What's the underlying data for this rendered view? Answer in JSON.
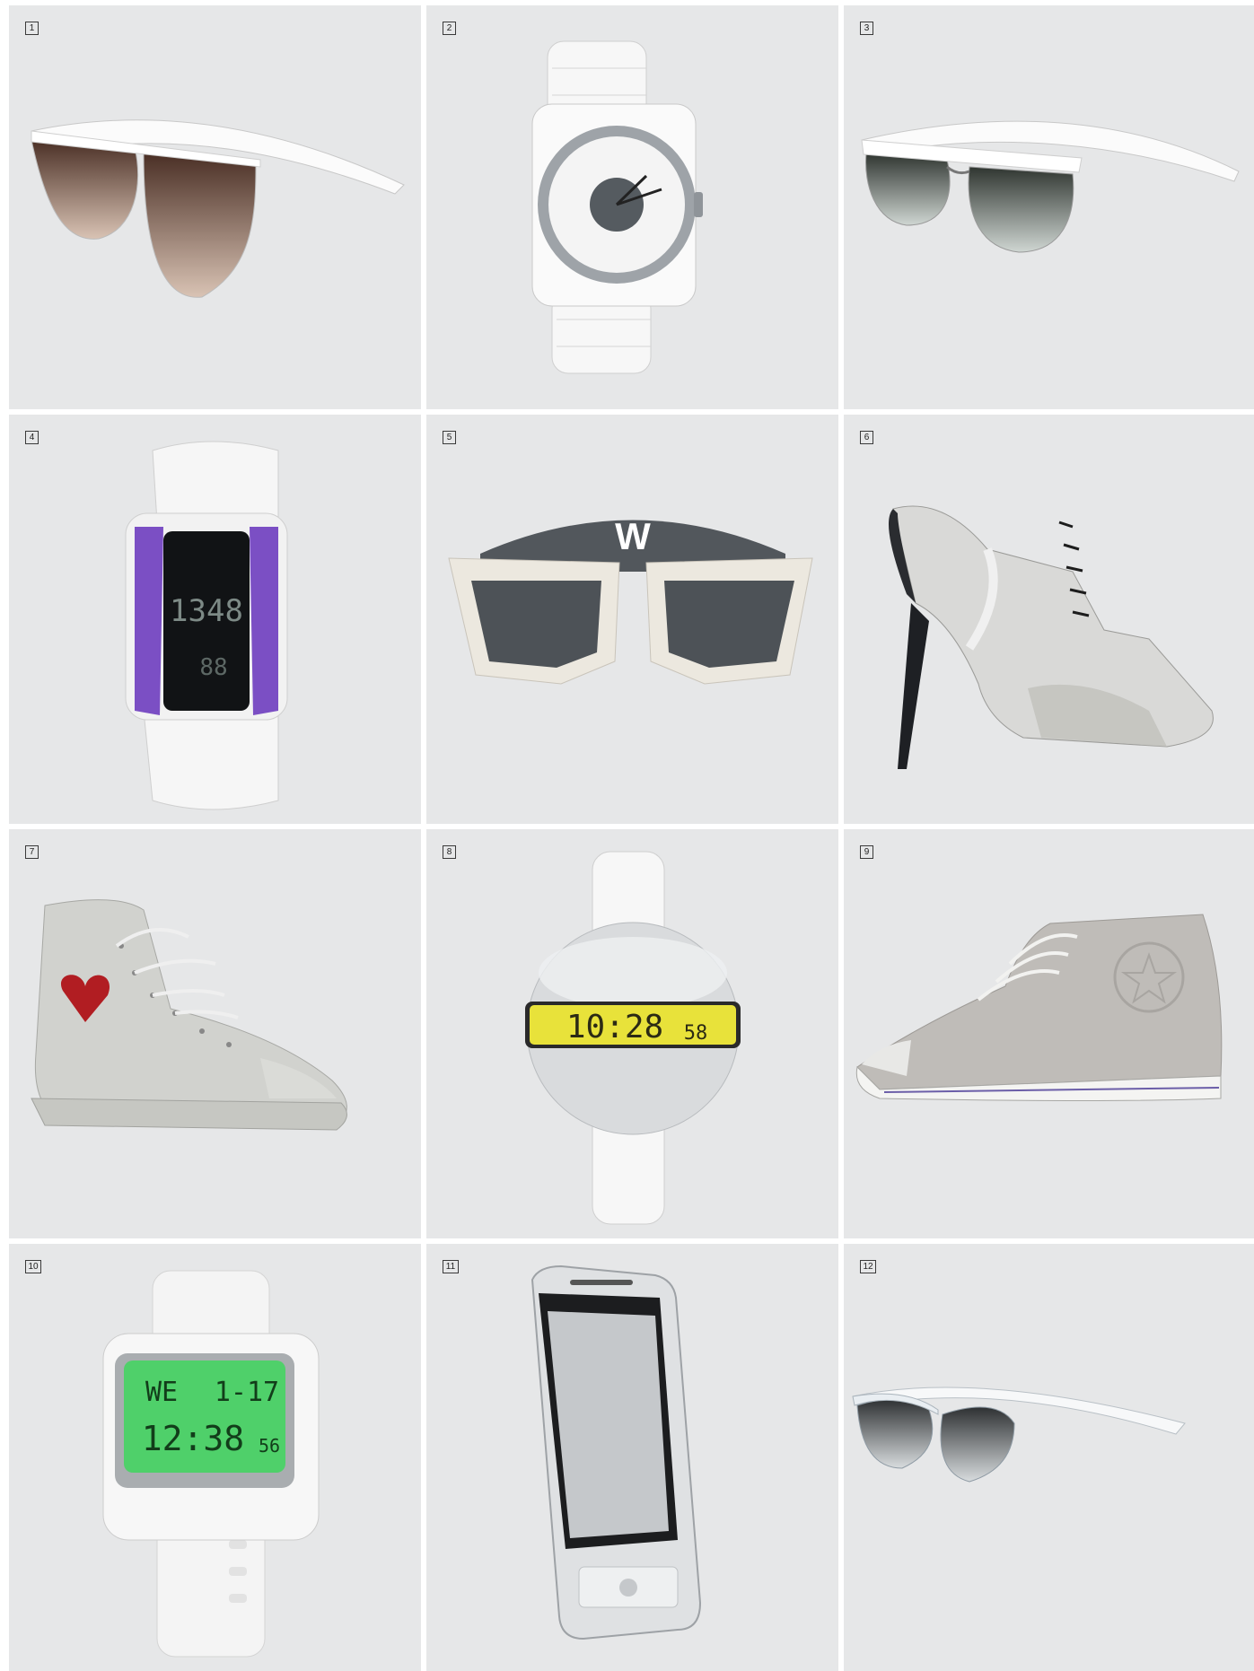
{
  "products": [
    {
      "number": "1",
      "icon": "sunglasses-icon"
    },
    {
      "number": "2",
      "icon": "analog-watch-icon"
    },
    {
      "number": "3",
      "icon": "sunglasses-icon"
    },
    {
      "number": "4",
      "icon": "digital-watch-icon",
      "display": "1348",
      "display2": "88"
    },
    {
      "number": "5",
      "icon": "sunglasses-icon",
      "logo": "W"
    },
    {
      "number": "6",
      "icon": "high-heel-shoe-icon"
    },
    {
      "number": "7",
      "icon": "sneaker-icon"
    },
    {
      "number": "8",
      "icon": "digital-watch-icon",
      "display": "10:28",
      "display_seconds": "58"
    },
    {
      "number": "9",
      "icon": "wedge-sneaker-icon"
    },
    {
      "number": "10",
      "icon": "digital-watch-icon",
      "display_day": "WE",
      "display_date": "1-17",
      "display": "12:38",
      "display_seconds": "56"
    },
    {
      "number": "11",
      "icon": "smartphone-icon"
    },
    {
      "number": "12",
      "icon": "sunglasses-icon"
    }
  ],
  "colors": {
    "cell_background": "#e6e7e8",
    "accent_purple": "#7b4fc4",
    "lcd_yellow": "#e8e23a",
    "lcd_green": "#4fd06a"
  }
}
